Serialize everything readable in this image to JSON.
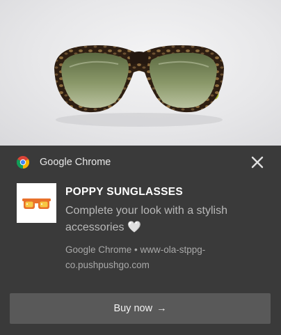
{
  "hero": {
    "image": "aviator-sunglasses-photo"
  },
  "notification": {
    "app_icon": "chrome-icon",
    "app_name": "Google Chrome",
    "close_icon": "close-icon",
    "thumbnail_icon": "sunglasses-icon",
    "title": "POPPY SUNGLASSES",
    "body": "Complete your look with a stylish accessories",
    "body_emoji": "🤍",
    "source": "Google Chrome • www-ola-stppg-co.pushpushgo.com",
    "action": {
      "label": "Buy now",
      "arrow": "→"
    }
  },
  "colors": {
    "panel_bg": "#3a3a3a",
    "button_bg": "#595959",
    "title": "#ffffff",
    "body": "#b9b9b9",
    "thumb_frame": "#e8702a",
    "thumb_lens": "#f7c844"
  }
}
